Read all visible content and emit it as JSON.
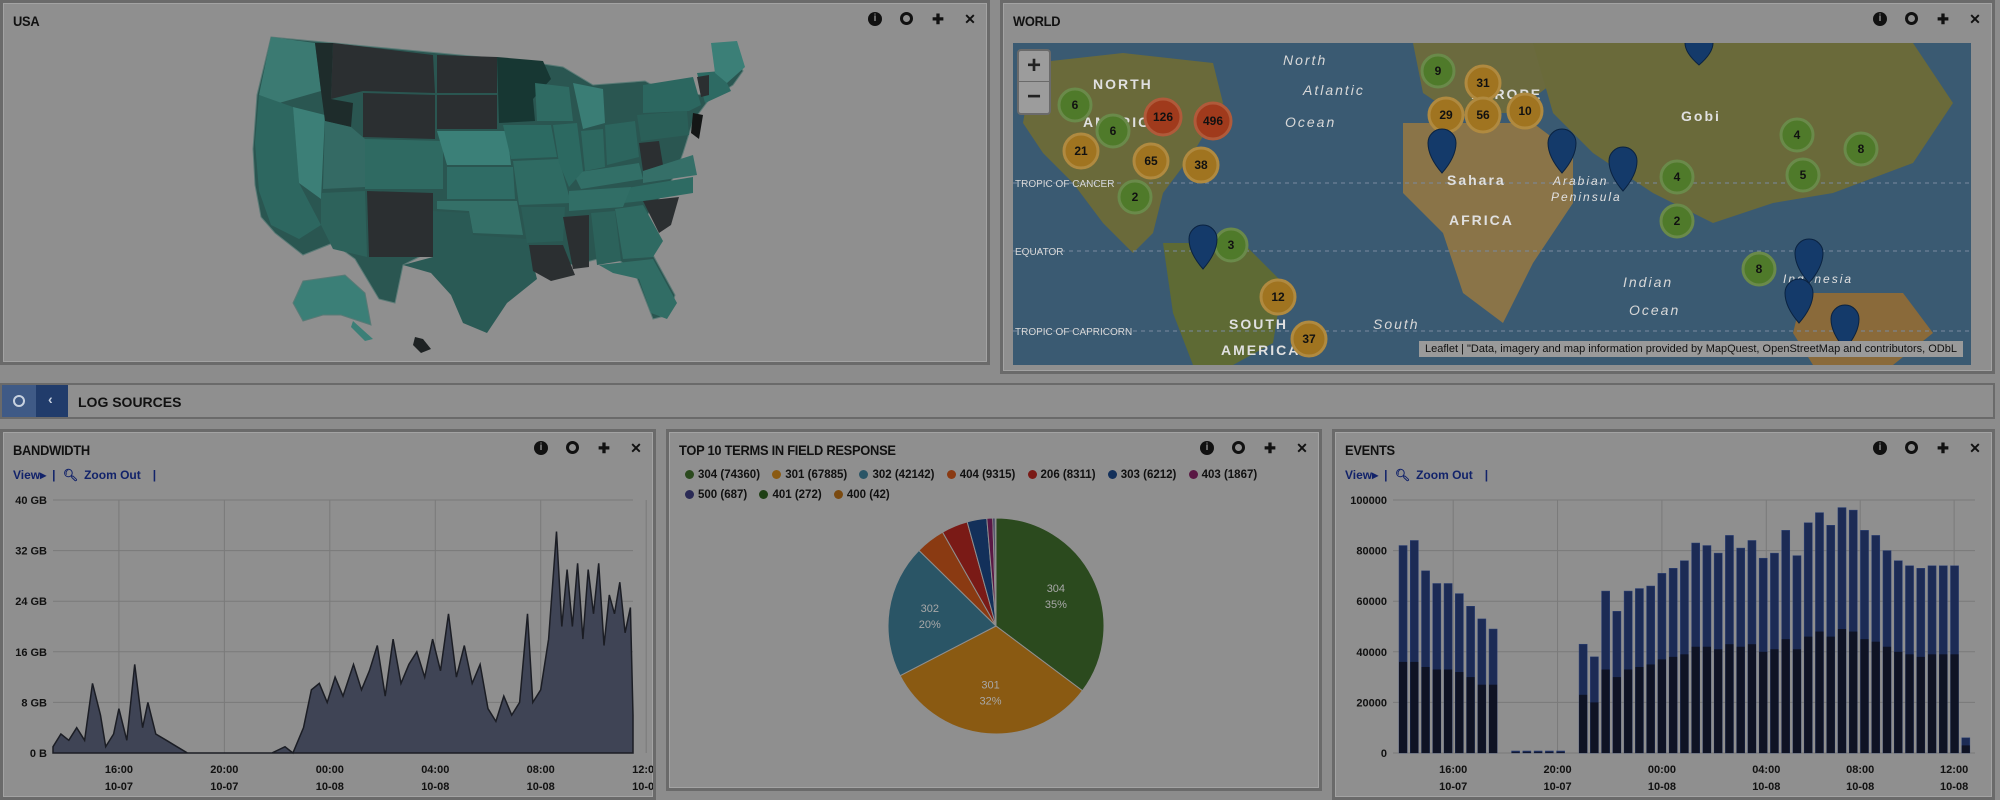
{
  "usa": {
    "title": "USA"
  },
  "world": {
    "title": "WORLD",
    "zoom_in": "+",
    "zoom_out": "−",
    "attribution": "Leaflet | \"Data, imagery and map information provided by MapQuest, OpenStreetMap and contributors, ODbL",
    "map_labels": [
      "North",
      "Atlantic",
      "Ocean",
      "NORTH",
      "AMERICA",
      "EUROPE",
      "Gobi",
      "Sahara",
      "AFRICA",
      "Arabian",
      "Peninsula",
      "Indian",
      "Ocean",
      "SOUTH",
      "AMERICA",
      "South",
      "TROPIC OF CANCER",
      "EQUATOR",
      "TROPIC OF CAPRICORN",
      "Indonesia"
    ],
    "clusters": [
      {
        "n": "9",
        "c": "green"
      },
      {
        "n": "31",
        "c": "orange"
      },
      {
        "n": "29",
        "c": "orange"
      },
      {
        "n": "56",
        "c": "orange"
      },
      {
        "n": "10",
        "c": "orange"
      },
      {
        "n": "6",
        "c": "green"
      },
      {
        "n": "6",
        "c": "green"
      },
      {
        "n": "126",
        "c": "red"
      },
      {
        "n": "496",
        "c": "red"
      },
      {
        "n": "21",
        "c": "orange"
      },
      {
        "n": "65",
        "c": "orange"
      },
      {
        "n": "38",
        "c": "orange"
      },
      {
        "n": "2",
        "c": "green"
      },
      {
        "n": "4",
        "c": "green"
      },
      {
        "n": "8",
        "c": "green"
      },
      {
        "n": "4",
        "c": "green"
      },
      {
        "n": "5",
        "c": "green"
      },
      {
        "n": "2",
        "c": "green"
      },
      {
        "n": "3",
        "c": "green"
      },
      {
        "n": "12",
        "c": "orange"
      },
      {
        "n": "37",
        "c": "orange"
      },
      {
        "n": "8",
        "c": "green"
      }
    ]
  },
  "logsources": {
    "title": "LOG SOURCES"
  },
  "bandwidth": {
    "title": "BANDWIDTH",
    "view_label": "View▸",
    "zoom_out_label": "Zoom Out"
  },
  "terms": {
    "title": "TOP 10 TERMS IN FIELD RESPONSE",
    "legend": [
      {
        "label": "304 (74360)",
        "color": "#2b4a1e"
      },
      {
        "label": "301 (67885)",
        "color": "#8a5a12"
      },
      {
        "label": "302 (42142)",
        "color": "#2a5566"
      },
      {
        "label": "404 (9315)",
        "color": "#8a3a12"
      },
      {
        "label": "206 (8311)",
        "color": "#7a1a16"
      },
      {
        "label": "303 (6212)",
        "color": "#13305a"
      },
      {
        "label": "403 (1867)",
        "color": "#5a1844"
      },
      {
        "label": "500 (687)",
        "color": "#2a2a55"
      },
      {
        "label": "401 (272)",
        "color": "#1e3f14"
      },
      {
        "label": "400 (42)",
        "color": "#7a4a10"
      }
    ],
    "slice_labels": [
      {
        "code": "304",
        "pct": "35%"
      },
      {
        "code": "301",
        "pct": "32%"
      },
      {
        "code": "302",
        "pct": "20%"
      }
    ]
  },
  "events": {
    "title": "EVENTS",
    "view_label": "View▸",
    "zoom_out_label": "Zoom Out"
  },
  "chart_data": [
    {
      "type": "area",
      "title": "BANDWIDTH",
      "y_ticks": [
        "0 B",
        "8 GB",
        "16 GB",
        "24 GB",
        "32 GB",
        "40 GB"
      ],
      "ylim": [
        0,
        40
      ],
      "x_ticks": [
        {
          "time": "16:00",
          "date": "10-07"
        },
        {
          "time": "20:00",
          "date": "10-07"
        },
        {
          "time": "00:00",
          "date": "10-08"
        },
        {
          "time": "04:00",
          "date": "10-08"
        },
        {
          "time": "08:00",
          "date": "10-08"
        },
        {
          "time": "12:00",
          "date": "10-08"
        }
      ],
      "x_hours_range": [
        13.5,
        35.5
      ],
      "series": [
        {
          "points": [
            [
              13.5,
              1
            ],
            [
              13.8,
              3
            ],
            [
              14.1,
              2
            ],
            [
              14.4,
              4
            ],
            [
              14.7,
              2
            ],
            [
              15,
              11
            ],
            [
              15.3,
              6
            ],
            [
              15.5,
              1
            ],
            [
              15.8,
              3
            ],
            [
              16,
              7
            ],
            [
              16.3,
              2
            ],
            [
              16.6,
              14
            ],
            [
              16.9,
              4
            ],
            [
              17.1,
              8
            ],
            [
              17.4,
              3
            ],
            [
              17.8,
              2
            ],
            [
              18.2,
              1
            ],
            [
              18.6,
              0
            ],
            [
              19,
              0
            ],
            [
              20,
              0
            ],
            [
              21,
              0
            ],
            [
              21.8,
              0
            ],
            [
              22.3,
              1
            ],
            [
              22.6,
              0
            ],
            [
              23,
              4
            ],
            [
              23.3,
              10
            ],
            [
              23.6,
              11
            ],
            [
              23.9,
              8
            ],
            [
              24.2,
              12
            ],
            [
              24.5,
              9
            ],
            [
              24.9,
              14
            ],
            [
              25.2,
              10
            ],
            [
              25.5,
              13
            ],
            [
              25.8,
              17
            ],
            [
              26.1,
              9
            ],
            [
              26.4,
              18
            ],
            [
              26.7,
              11
            ],
            [
              27,
              14
            ],
            [
              27.3,
              16
            ],
            [
              27.6,
              12
            ],
            [
              27.9,
              18
            ],
            [
              28.2,
              13
            ],
            [
              28.5,
              22
            ],
            [
              28.8,
              12
            ],
            [
              29.1,
              17
            ],
            [
              29.4,
              11
            ],
            [
              29.7,
              14
            ],
            [
              30,
              7
            ],
            [
              30.3,
              5
            ],
            [
              30.6,
              9
            ],
            [
              30.9,
              6
            ],
            [
              31.2,
              8
            ],
            [
              31.5,
              22
            ],
            [
              31.7,
              8
            ],
            [
              32,
              10
            ],
            [
              32.3,
              18
            ],
            [
              32.6,
              35
            ],
            [
              32.8,
              20
            ],
            [
              33,
              29
            ],
            [
              33.2,
              20
            ],
            [
              33.4,
              30
            ],
            [
              33.6,
              18
            ],
            [
              33.8,
              29
            ],
            [
              34,
              22
            ],
            [
              34.2,
              30
            ],
            [
              34.4,
              17
            ],
            [
              34.6,
              25
            ],
            [
              34.8,
              22
            ],
            [
              35,
              27
            ],
            [
              35.2,
              19
            ],
            [
              35.4,
              23
            ],
            [
              35.5,
              6
            ]
          ]
        }
      ]
    },
    {
      "type": "pie",
      "title": "TOP 10 TERMS IN FIELD RESPONSE",
      "categories": [
        "304",
        "301",
        "302",
        "404",
        "206",
        "303",
        "403",
        "500",
        "401",
        "400"
      ],
      "values": [
        74360,
        67885,
        42142,
        9315,
        8311,
        6212,
        1867,
        687,
        272,
        42
      ]
    },
    {
      "type": "bar",
      "title": "EVENTS",
      "y_ticks": [
        "0",
        "20000",
        "40000",
        "60000",
        "80000",
        "100000"
      ],
      "ylim": [
        0,
        100000
      ],
      "x_ticks": [
        {
          "time": "16:00",
          "date": "10-07"
        },
        {
          "time": "20:00",
          "date": "10-07"
        },
        {
          "time": "00:00",
          "date": "10-08"
        },
        {
          "time": "04:00",
          "date": "10-08"
        },
        {
          "time": "08:00",
          "date": "10-08"
        },
        {
          "time": "12:00",
          "date": "10-08"
        }
      ],
      "series": [
        {
          "values": [
            82000,
            84000,
            72000,
            67000,
            67000,
            63000,
            58000,
            53000,
            49000,
            0,
            800,
            800,
            800,
            800,
            800,
            0,
            43000,
            38000,
            64000,
            56000,
            64000,
            65000,
            66000,
            71000,
            73000,
            76000,
            83000,
            82000,
            79000,
            86000,
            81000,
            84000,
            77000,
            79000,
            88000,
            78000,
            91000,
            95000,
            90000,
            97000,
            96000,
            88000,
            86000,
            80000,
            76000,
            74000,
            73000,
            74000,
            74000,
            74000,
            6000
          ]
        },
        {
          "values": [
            36000,
            36000,
            34000,
            33000,
            33000,
            32000,
            30000,
            27000,
            27000,
            0,
            300,
            300,
            300,
            300,
            300,
            0,
            23000,
            20000,
            33000,
            30000,
            33000,
            34000,
            35000,
            37000,
            38000,
            39000,
            42000,
            42000,
            41000,
            43000,
            42000,
            43000,
            40000,
            41000,
            45000,
            41000,
            46000,
            48000,
            46000,
            49000,
            48000,
            45000,
            44000,
            42000,
            40000,
            39000,
            38000,
            39000,
            39000,
            39000,
            3000
          ]
        }
      ]
    }
  ]
}
